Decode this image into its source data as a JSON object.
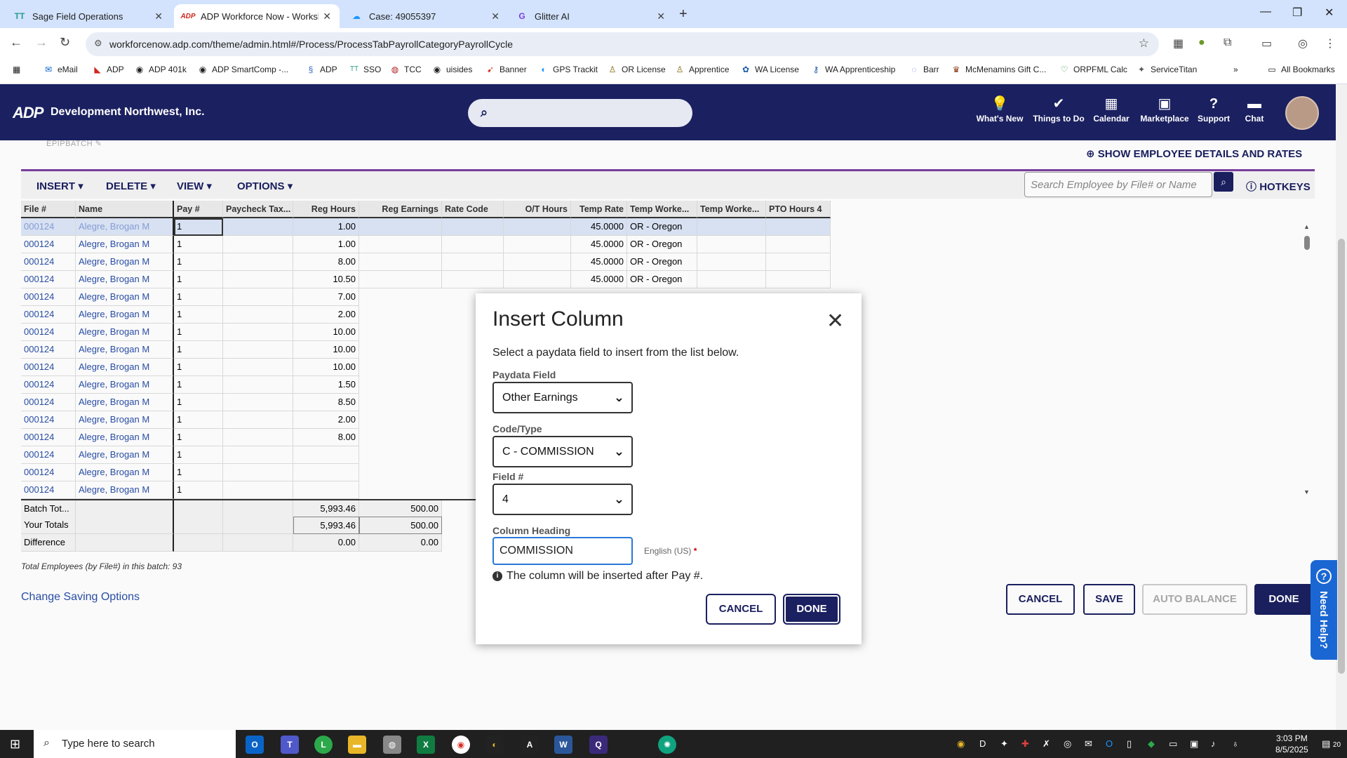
{
  "browser": {
    "tabs": [
      {
        "label": "Sage Field Operations",
        "icon": "TT"
      },
      {
        "label": "ADP Workforce Now - Workshe",
        "icon": "ADP"
      },
      {
        "label": "Case: 49055397",
        "icon": "cloud"
      },
      {
        "label": "Glitter AI",
        "icon": "G"
      }
    ],
    "url": "workforcenow.adp.com/theme/admin.html#/Process/ProcessTabPayrollCategoryPayrollCycle",
    "bookmarks": [
      "eMail",
      "ADP",
      "ADP 401k",
      "ADP SmartComp -...",
      "ADP",
      "SSO",
      "TCC",
      "uisides",
      "Banner",
      "GPS Trackit",
      "OR License",
      "Apprentice",
      "WA License",
      "WA Apprenticeship",
      "Barr",
      "McMenamins Gift C...",
      "ORPFML Calc",
      "ServiceTitan"
    ],
    "all_bookmarks": "All Bookmarks"
  },
  "header": {
    "logo": "ADP",
    "company": "Development Northwest, Inc.",
    "nav": [
      "What's New",
      "Things to Do",
      "Calendar",
      "Marketplace",
      "Support",
      "Chat"
    ]
  },
  "worksheet": {
    "batch_label": "EPIPBATCH",
    "show_details": "SHOW EMPLOYEE DETAILS AND RATES",
    "menus": [
      "INSERT",
      "DELETE",
      "VIEW",
      "OPTIONS"
    ],
    "search_placeholder": "Search Employee by File# or Name",
    "hotkeys": "HOTKEYS",
    "columns": [
      "File #",
      "Name",
      "Pay #",
      "Paycheck Tax...",
      "Reg Hours",
      "Reg Earnings",
      "Rate Code",
      "O/T Hours",
      "Temp Rate",
      "Temp Worke...",
      "Temp Worke...",
      "PTO Hours 4"
    ],
    "rows": [
      [
        "000124",
        "Alegre, Brogan M",
        "1",
        "",
        "1.00",
        "",
        "",
        "",
        "45.0000",
        "OR - Oregon",
        "",
        ""
      ],
      [
        "000124",
        "Alegre, Brogan M",
        "1",
        "",
        "1.00",
        "",
        "",
        "",
        "45.0000",
        "OR - Oregon",
        "",
        ""
      ],
      [
        "000124",
        "Alegre, Brogan M",
        "1",
        "",
        "8.00",
        "",
        "",
        "",
        "45.0000",
        "OR - Oregon",
        "",
        ""
      ],
      [
        "000124",
        "Alegre, Brogan M",
        "1",
        "",
        "10.50",
        "",
        "",
        "",
        "45.0000",
        "OR - Oregon",
        "",
        ""
      ],
      [
        "000124",
        "Alegre, Brogan M",
        "1",
        "",
        "7.00",
        "",
        "",
        "",
        "",
        "",
        "",
        ""
      ],
      [
        "000124",
        "Alegre, Brogan M",
        "1",
        "",
        "2.00",
        "",
        "",
        "",
        "",
        "",
        "",
        ""
      ],
      [
        "000124",
        "Alegre, Brogan M",
        "1",
        "",
        "10.00",
        "",
        "",
        "",
        "",
        "",
        "",
        ""
      ],
      [
        "000124",
        "Alegre, Brogan M",
        "1",
        "",
        "10.00",
        "",
        "",
        "",
        "",
        "",
        "",
        ""
      ],
      [
        "000124",
        "Alegre, Brogan M",
        "1",
        "",
        "10.00",
        "",
        "",
        "",
        "",
        "",
        "",
        ""
      ],
      [
        "000124",
        "Alegre, Brogan M",
        "1",
        "",
        "1.50",
        "",
        "",
        "",
        "",
        "",
        "",
        ""
      ],
      [
        "000124",
        "Alegre, Brogan M",
        "1",
        "",
        "8.50",
        "",
        "",
        "",
        "",
        "",
        "",
        ""
      ],
      [
        "000124",
        "Alegre, Brogan M",
        "1",
        "",
        "2.00",
        "",
        "",
        "",
        "",
        "",
        "",
        ""
      ],
      [
        "000124",
        "Alegre, Brogan M",
        "1",
        "",
        "8.00",
        "",
        "",
        "",
        "",
        "",
        "",
        ""
      ],
      [
        "000124",
        "Alegre, Brogan M",
        "1",
        "",
        "",
        "",
        "",
        "",
        "",
        "",
        "",
        ""
      ],
      [
        "000124",
        "Alegre, Brogan M",
        "1",
        "",
        "",
        "",
        "",
        "",
        "",
        "",
        "",
        ""
      ],
      [
        "000124",
        "Alegre, Brogan M",
        "1",
        "",
        "",
        "",
        "",
        "",
        "",
        "",
        "",
        ""
      ]
    ],
    "totals": [
      {
        "label": "Batch Tot...",
        "reg_hours": "5,993.46",
        "reg_earnings": "500.00"
      },
      {
        "label": "Your Totals",
        "reg_hours": "5,993.46",
        "reg_earnings": "500.00"
      },
      {
        "label": "Difference",
        "reg_hours": "0.00",
        "reg_earnings": "0.00"
      }
    ],
    "total_employees": "Total Employees (by File#) in this batch: 93",
    "change_saving": "Change Saving Options",
    "buttons": {
      "cancel": "CANCEL",
      "save": "SAVE",
      "auto_balance": "AUTO BALANCE",
      "done": "DONE"
    },
    "need_help": "Need Help?"
  },
  "modal": {
    "title": "Insert Column",
    "description": "Select a paydata field to insert from the list below.",
    "paydata_label": "Paydata Field",
    "paydata_value": "Other Earnings",
    "code_label": "Code/Type",
    "code_value": "C - COMMISSION",
    "field_label": "Field #",
    "field_value": "4",
    "heading_label": "Column Heading",
    "heading_value": "COMMISSION",
    "language": "English (US)",
    "required_mark": "*",
    "info": "The column will be inserted after Pay #.",
    "cancel": "CANCEL",
    "done": "DONE"
  },
  "taskbar": {
    "search_placeholder": "Type here to search",
    "time": "3:03 PM",
    "date": "8/5/2025",
    "notifications": "20"
  }
}
